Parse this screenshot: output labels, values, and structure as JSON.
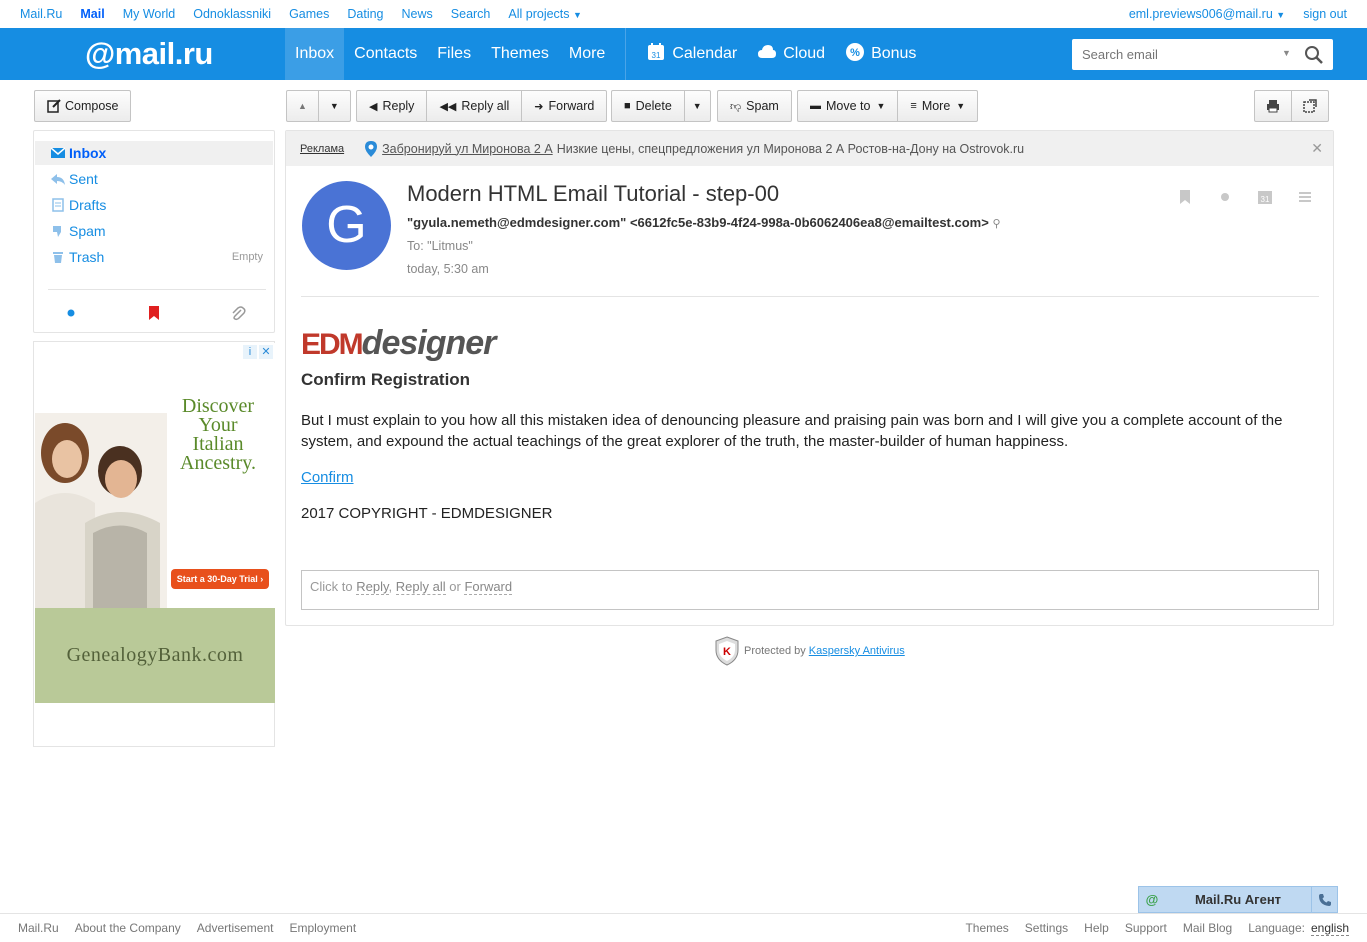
{
  "portal": {
    "links": [
      "Mail.Ru",
      "Mail",
      "My World",
      "Odnoklassniki",
      "Games",
      "Dating",
      "News",
      "Search",
      "All projects"
    ],
    "user_email": "eml.previews006@mail.ru",
    "sign_out": "sign out"
  },
  "header": {
    "logo": "@mail.ru",
    "nav": [
      "Inbox",
      "Contacts",
      "Files",
      "Themes",
      "More"
    ],
    "services": [
      "Calendar",
      "Cloud",
      "Bonus"
    ],
    "search_placeholder": "Search email"
  },
  "toolbar": {
    "compose": "Compose",
    "reply": "Reply",
    "reply_all": "Reply all",
    "forward": "Forward",
    "delete": "Delete",
    "spam": "Spam",
    "move_to": "Move to",
    "more": "More"
  },
  "sidebar": {
    "folders": [
      {
        "label": "Inbox",
        "icon": "inbox-icon"
      },
      {
        "label": "Sent",
        "icon": "sent-icon"
      },
      {
        "label": "Drafts",
        "icon": "drafts-icon"
      },
      {
        "label": "Spam",
        "icon": "spam-icon"
      },
      {
        "label": "Trash",
        "icon": "trash-icon"
      }
    ],
    "trash_action": "Empty"
  },
  "sidebar_ad": {
    "headline": "Discover Your Italian Ancestry.",
    "cta": "Start a 30-Day Trial ›",
    "brand": "GenealogyBank.com"
  },
  "ad_line": {
    "label": "Реклама",
    "link": "Забронируй ул Миронова 2 А",
    "text": "Низкие цены, спецпредложения ул Миронова 2 А Ростов-на-Дону на Ostrovok.ru"
  },
  "message": {
    "avatar_letter": "G",
    "subject": "Modern HTML Email Tutorial - step-00",
    "from": "\"gyula.nemeth@edmdesigner.com\" <6612fc5e-83b9-4f24-998a-0b6062406ea8@emailtest.com>",
    "to": "To: \"Litmus\"",
    "date": "today, 5:30 am",
    "brand_a": "EDM",
    "brand_b": "designer",
    "title": "Confirm Registration",
    "body": "But I must explain to you how all this mistaken idea of denouncing pleasure and praising pain was born and I will give you a complete account of the system, and expound the actual teachings of the great explorer of the truth, the master-builder of human happiness.",
    "confirm": "Confirm",
    "copyright": "2017 COPYRIGHT - EDMDESIGNER"
  },
  "reply_box": {
    "prefix": "Click to",
    "reply": "Reply",
    "reply_all": "Reply all",
    "or": "or",
    "forward": "Forward"
  },
  "protection": {
    "text": "Protected by",
    "link": "Kaspersky Antivirus"
  },
  "agent": {
    "name": "Mail.Ru Агент"
  },
  "footer": {
    "left": [
      "Mail.Ru",
      "About the Company",
      "Advertisement",
      "Employment"
    ],
    "right": [
      "Themes",
      "Settings",
      "Help",
      "Support",
      "Mail Blog"
    ],
    "language_label": "Language:",
    "language": "english"
  },
  "colors": {
    "brand_blue": "#168de2",
    "brand_orange": "#ff9e00",
    "avatar": "#4a73d5"
  }
}
